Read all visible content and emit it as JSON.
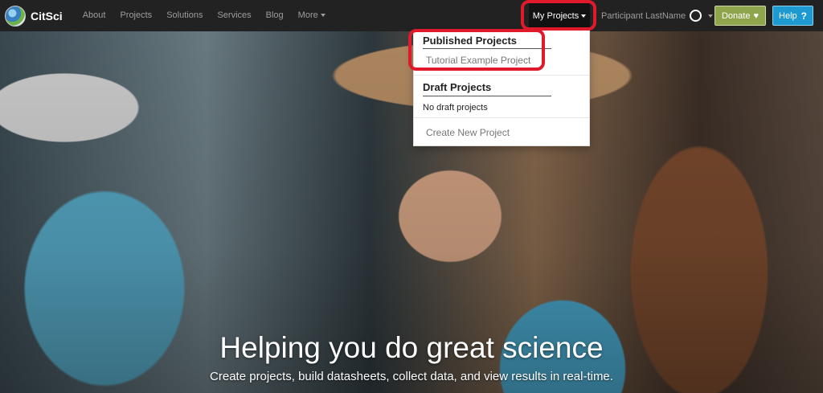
{
  "brand": {
    "name": "CitSci"
  },
  "nav": {
    "links": [
      "About",
      "Projects",
      "Solutions",
      "Services",
      "Blog"
    ],
    "more_label": "More"
  },
  "my_projects": {
    "label": "My Projects"
  },
  "user": {
    "name": "Participant LastName"
  },
  "donate": {
    "label": "Donate",
    "icon": "heart-icon"
  },
  "help": {
    "label": "Help",
    "icon": "question-icon"
  },
  "dropdown": {
    "published_header": "Published Projects",
    "published_items": [
      "Tutorial Example Project"
    ],
    "draft_header": "Draft Projects",
    "draft_empty": "No draft projects",
    "create_label": "Create New Project"
  },
  "hero": {
    "title": "Helping you do great science",
    "subtitle": "Create projects, build datasheets, collect data, and view results in real-time."
  },
  "colors": {
    "navbar": "#222222",
    "donate": "#8fa54c",
    "help": "#1d9ad1",
    "highlight": "#e01a2b"
  }
}
